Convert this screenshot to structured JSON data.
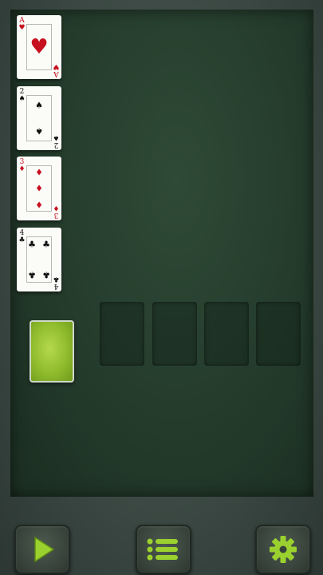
{
  "tableau": {
    "cards": [
      {
        "rank": "A",
        "suit": "♥",
        "suit_name": "hearts",
        "color": "#c7101f"
      },
      {
        "rank": "2",
        "suit": "♠",
        "suit_name": "spades",
        "color": "#111111"
      },
      {
        "rank": "3",
        "suit": "♦",
        "suit_name": "diamonds",
        "color": "#c7101f"
      },
      {
        "rank": "4",
        "suit": "♣",
        "suit_name": "clubs",
        "color": "#111111"
      }
    ]
  },
  "stock": {
    "back_color": "#9fc83a"
  },
  "foundations": {
    "count": 4
  },
  "toolbar": {
    "play_icon": "play-icon",
    "menu_icon": "menu-list-icon",
    "settings_icon": "gear-icon",
    "accent": "#9bd12f"
  }
}
